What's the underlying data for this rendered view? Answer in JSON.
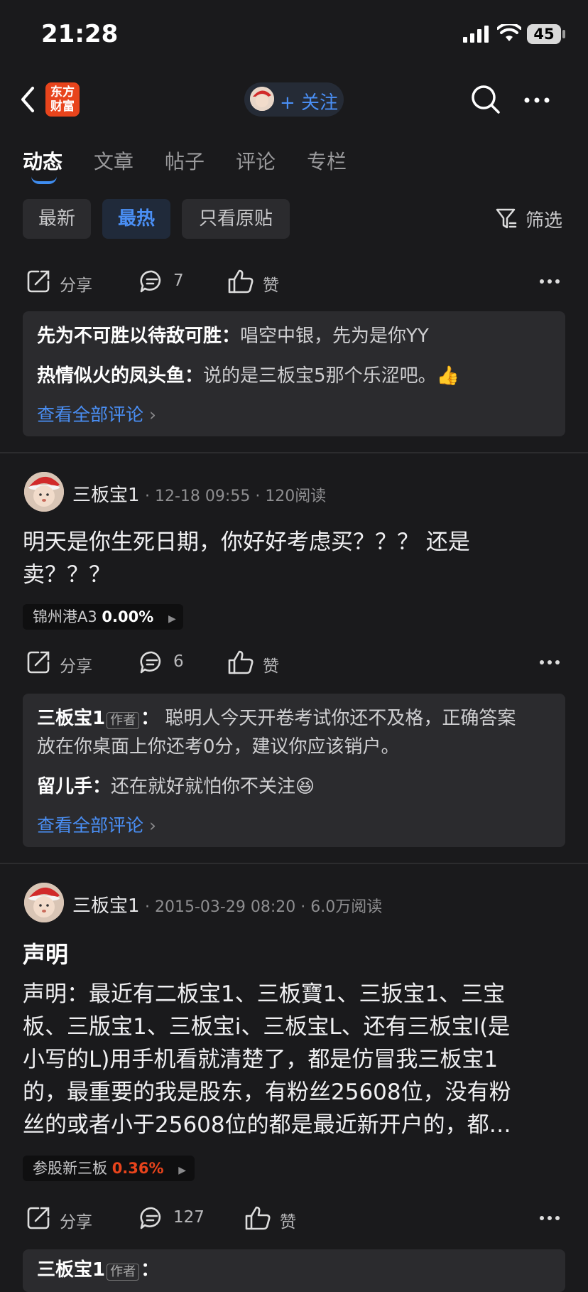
{
  "status_bar": {
    "time": "21:28",
    "battery": "45"
  },
  "nav": {
    "logo_line1": "东方",
    "logo_line2": "财富",
    "follow_label": "+ 关注"
  },
  "tabs": [
    "动态",
    "文章",
    "帖子",
    "评论",
    "专栏"
  ],
  "chips": [
    "最新",
    "最热",
    "只看原贴"
  ],
  "filter_label": "筛选",
  "post0": {
    "share": "分享",
    "comments": "7",
    "like": "赞",
    "comment1_user": "先为不可胜以待敌可胜",
    "comment1_text": "唱空中银，先为是你YY",
    "comment2_user": "热情似火的凤头鱼",
    "comment2_text": "说的是三板宝5那个乐涩吧。👍",
    "see_all": "查看全部评论"
  },
  "post1": {
    "author": "三板宝1",
    "date": "12-18 09:55",
    "reads": "120阅读",
    "text_line1": "明天是你生死日期，你好好考虑买？？？ 还是",
    "text_line2": "卖？？？",
    "stock_name": "锦州港A3",
    "stock_pct": "0.00%",
    "share": "分享",
    "comments": "6",
    "like": "赞",
    "comment1_user": "三板宝1",
    "author_badge": "作者",
    "comment1_text_a": "聪明人今天开卷考试你还不及格，正确答案",
    "comment1_text_b": "放在你桌面上你还考0分，建议你应该销户。",
    "comment2_user": "留儿手",
    "comment2_text": "还在就好就怕你不关注😆",
    "see_all": "查看全部评论"
  },
  "post2": {
    "author": "三板宝1",
    "date": "2015-03-29 08:20",
    "reads": "6.0万阅读",
    "title": "声明",
    "lines": [
      "声明：最近有二板宝1、三板寶1、三扳宝1、三宝",
      "板、三版宝1、三板宝i、三板宝L、还有三板宝l(是",
      "小写的L)用手机看就清楚了，都是仿冒我三板宝1",
      "的，最重要的我是股东，有粉丝25608位，没有粉",
      "丝的或者小于25608位的都是最近新开户的，都…"
    ],
    "stock_name": "参股新三板",
    "stock_pct": "0.36%",
    "share": "分享",
    "comments": "127",
    "like": "赞",
    "comment_preview_user": "三板宝1",
    "comment_preview_badge": "作者"
  },
  "colors": {
    "accent": "#4a8ff5",
    "up": "#e8441c",
    "background": "#1a1a1c"
  }
}
